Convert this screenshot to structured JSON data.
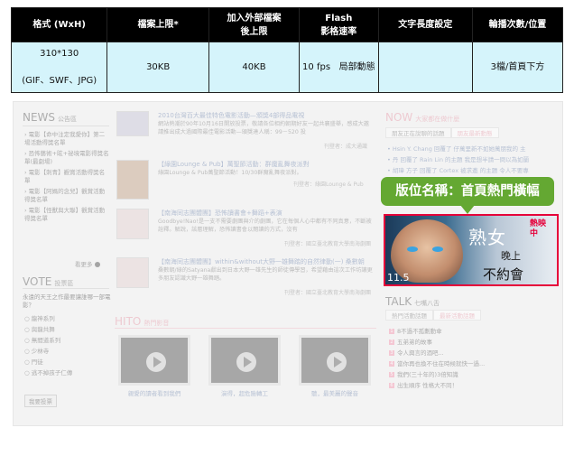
{
  "spec": {
    "headers": [
      {
        "line1": "格式 (WxH)",
        "line2": ""
      },
      {
        "line1": "檔案上限*",
        "line2": ""
      },
      {
        "line1": "加入外部檔案",
        "line2": "後上限"
      },
      {
        "line1": "Flash",
        "line2": "影格速率"
      },
      {
        "line1": "文字長度設定",
        "line2": ""
      },
      {
        "line1": "輪播次數/位置",
        "line2": ""
      }
    ],
    "row": {
      "format_line1": "310*130",
      "format_line2": "(GIF、SWF、JPG)",
      "file_limit": "30KB",
      "external_limit": "40KB",
      "flash_fps": "10 fps",
      "flash_note": "局部動態",
      "text_length": "",
      "rotation": "3檔/首頁下方"
    }
  },
  "site": {
    "news": {
      "title": "NEWS",
      "subtitle": "公告區",
      "items": [
        "電影【命中注定我愛你】第二場活動得獎名單",
        "恐怖藝術+眩+祕境電影得獎名單(最劇場)",
        "電影【刺青】觀賞活動得獎名單",
        "電影【阿媽的念兒】觀賞活動得獎名單",
        "電影【怪獸與大聯】觀賞活動得獎名單"
      ],
      "more": "看更多"
    },
    "vote": {
      "title": "VOTE",
      "subtitle": "投票區",
      "question": "永遠的天王之作最要讓誰哪一部電影？",
      "options": [
        "龍神系列",
        "與龍共舞",
        "無間道系列",
        "少林寺",
        "門徒",
        "逃不掉孩子仁傳"
      ],
      "button": "我要投票"
    },
    "articles": [
      {
        "title": "2010台灣百大最佳特色電影活動—頒獎4部得品電視",
        "desc": "網站熱潮於90年10月16日開放投票，敬請各位相約朝期好友一起共襄盛舉，感成大邀請推出成大過國際最佳電影活動—頒獎達人稱：99－520 投",
        "source": "刊登者：成大通識"
      },
      {
        "title": "【綠園Lounge & Pub】萬聖節活動：群魔亂舞夜派對",
        "desc": "綠園Lounge & Pub萬聖節活動！10/30群魔亂舞夜派對。",
        "source": "刊登者：綠園Lounge & Pub"
      },
      {
        "title": "【南海同志團體團】恐怖讀書會+舞蹈+表演",
        "desc": "Goodbye!Nao!是一支不需要劇團與介的劇團，它在每個人心中都有不同真意，不斷被詮釋。解說，該層理解，恐怖讀書會以閱讀的方式，沒有",
        "source": "刊登者：國立臺北教育大學南海劇團"
      },
      {
        "title": "【南海同志團體團】within&without大野一雄舞踏的自然律動(一) 桑數朝",
        "desc": "桑數朝/綠的Satyana獻出到日本大野一雄先生的師徒傳學習，希望藉由這次工作坊讓更多朋友認識大野一雄舞踏。",
        "source": "刊登者：國立臺北教育大學南海劇團"
      }
    ],
    "hito": {
      "title": "HITO",
      "subtitle": "熱門影音",
      "videos": [
        "親愛的讀者看到我們",
        "演得，超危險轉工",
        "聽，最美麗的聲音"
      ]
    },
    "now": {
      "title": "NOW",
      "subtitle": "大家都在做什麼",
      "tabs": [
        "朋友正在說聊的話題",
        "朋友最新動態"
      ],
      "items": [
        "Hsin Y. Chang 回覆了 仔萬里新不如她萬朋我的 主",
        "丹 回覆了 Rain Lin 的主題 我是想半請一問以為如蘭",
        "胡瑋 方子 回覆了 Cortex 被求邀 的主題 令人不要專"
      ]
    },
    "talk": {
      "title": "TALK",
      "subtitle": "七嘴八舌",
      "tabs": [
        "熱門活動話題",
        "最新活動話題"
      ],
      "items": [
        "8不過不孤劃動傘",
        "五弟弟的故事",
        "令人興言的酒吧...",
        "當你再也換不住在時候就快一過...",
        "我們(三十年的)3倍知識",
        "出生順序 性格大不同！"
      ]
    },
    "ad": {
      "callout": "版位名稱：首頁熱門橫幅",
      "title": "熟女",
      "line2": "晚上",
      "line3": "不約會",
      "date": "11.5",
      "stamp": "熱映中"
    }
  }
}
